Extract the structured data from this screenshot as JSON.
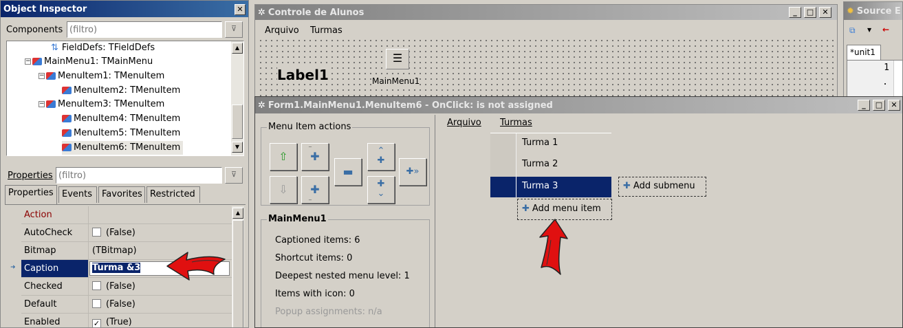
{
  "object_inspector": {
    "title": "Object Inspector",
    "components_label": "Components",
    "components_filter_placeholder": "(filtro)",
    "tree": [
      {
        "label": "FieldDefs: TFieldDefs"
      },
      {
        "label": "MainMenu1: TMainMenu"
      },
      {
        "label": "MenuItem1: TMenuItem"
      },
      {
        "label": "MenuItem2: TMenuItem"
      },
      {
        "label": "MenuItem3: TMenuItem"
      },
      {
        "label": "MenuItem4: TMenuItem"
      },
      {
        "label": "MenuItem5: TMenuItem"
      },
      {
        "label": "MenuItem6: TMenuItem"
      }
    ],
    "properties_label": "Properties",
    "properties_filter_placeholder": "(filtro)",
    "tabs": [
      "Properties",
      "Events",
      "Favorites",
      "Restricted"
    ],
    "rows": [
      {
        "name": "Action",
        "value": ""
      },
      {
        "name": "AutoCheck",
        "value": "(False)"
      },
      {
        "name": "Bitmap",
        "value": "(TBitmap)"
      },
      {
        "name": "Caption",
        "value": "Turma &3"
      },
      {
        "name": "Checked",
        "value": "(False)"
      },
      {
        "name": "Default",
        "value": "(False)"
      },
      {
        "name": "Enabled",
        "value": "(True)"
      }
    ]
  },
  "form": {
    "title": "Controle de Alunos",
    "menu": [
      "Arquivo",
      "Turmas"
    ],
    "label1": "Label1",
    "component_label": "MainMenu1"
  },
  "source_editor": {
    "title": "Source E",
    "tab": "*unit1",
    "line_number": "1",
    "line_dot": "."
  },
  "menu_editor": {
    "title": "Form1.MainMenu1.MenuItem6 - OnClick: is not assigned",
    "actions_group": "Menu Item actions",
    "stats_group": "MainMenu1",
    "stats": [
      "Captioned items: 6",
      "Shortcut items: 0",
      "Deepest nested menu level: 1",
      "Items with icon: 0",
      "Popup assignments: n/a"
    ],
    "menubar": [
      "Arquivo",
      "Turmas"
    ],
    "submenu_items": [
      "Turma 1",
      "Turma 2",
      "Turma 3"
    ],
    "add_submenu": "Add submenu",
    "add_menu_item": "Add menu item"
  }
}
